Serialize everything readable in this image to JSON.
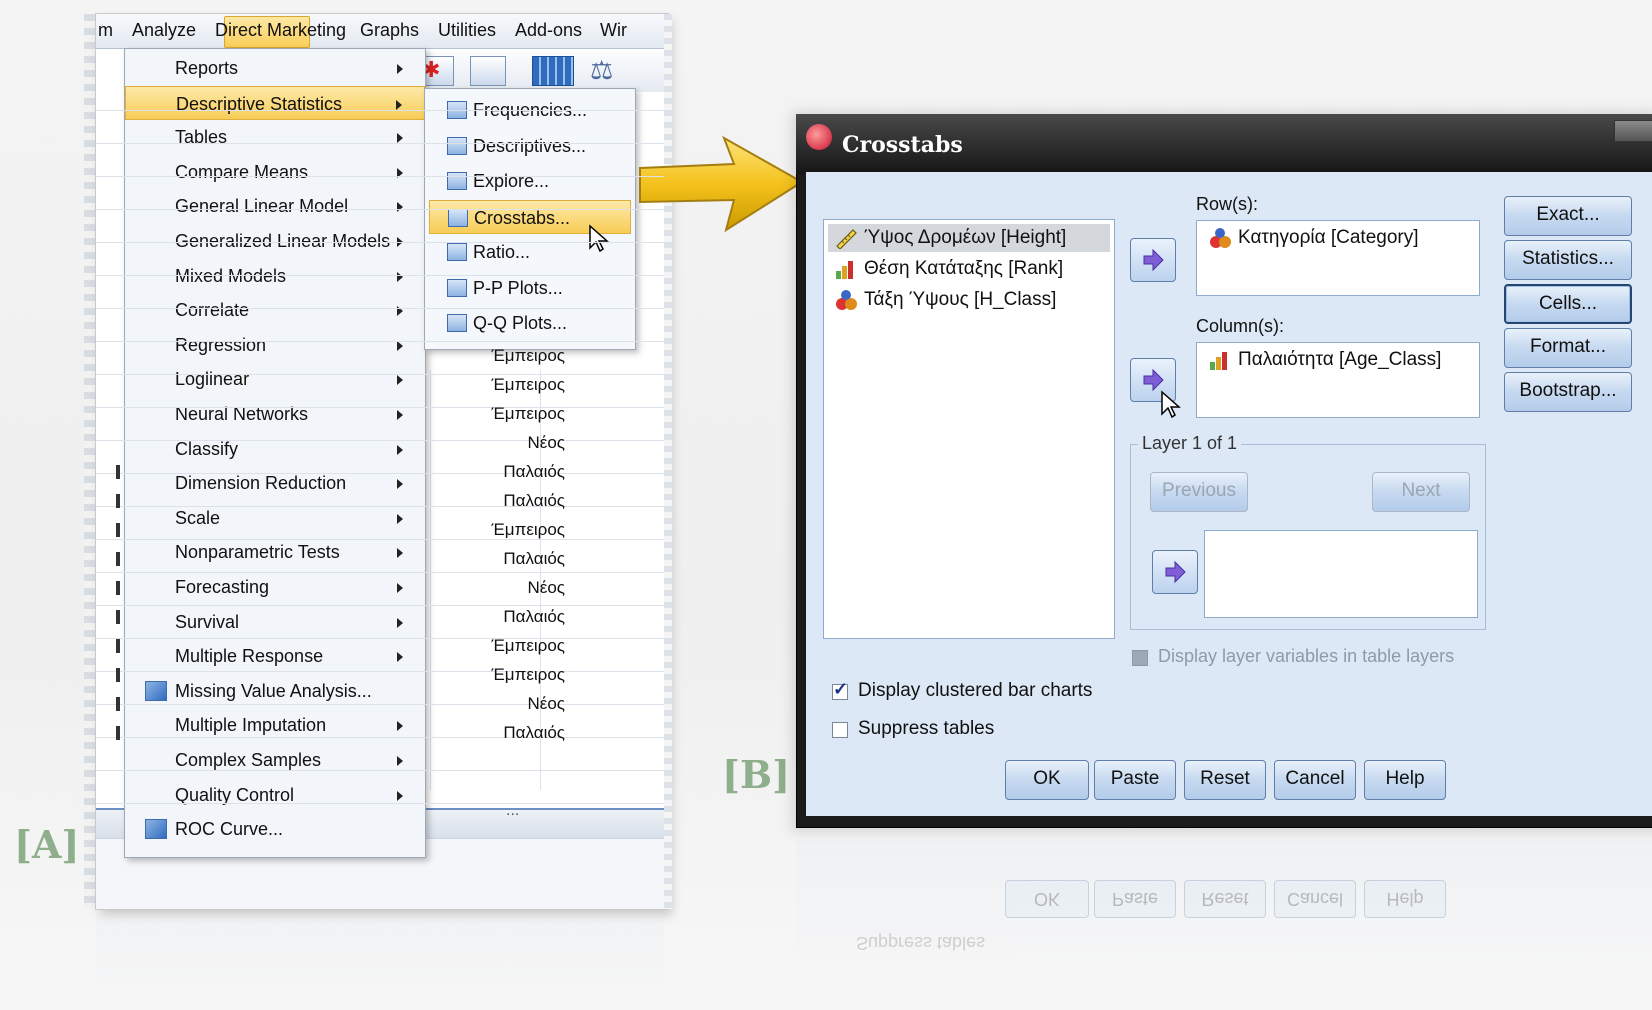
{
  "menubar": {
    "items": [
      "m",
      "Analyze",
      "Direct Marketing",
      "Graphs",
      "Utilities",
      "Add-ons",
      "Wir"
    ],
    "active": "Analyze"
  },
  "analyze_menu": [
    {
      "label": "Reports",
      "submenu": true
    },
    {
      "label": "Descriptive Statistics",
      "submenu": true,
      "selected": true
    },
    {
      "label": "Tables",
      "submenu": true
    },
    {
      "label": "Compare Means",
      "submenu": true
    },
    {
      "label": "General Linear Model",
      "submenu": true
    },
    {
      "label": "Generalized Linear Models",
      "submenu": true
    },
    {
      "label": "Mixed Models",
      "submenu": true
    },
    {
      "label": "Correlate",
      "submenu": true
    },
    {
      "label": "Regression",
      "submenu": true
    },
    {
      "label": "Loglinear",
      "submenu": true
    },
    {
      "label": "Neural Networks",
      "submenu": true
    },
    {
      "label": "Classify",
      "submenu": true
    },
    {
      "label": "Dimension Reduction",
      "submenu": true
    },
    {
      "label": "Scale",
      "submenu": true
    },
    {
      "label": "Nonparametric Tests",
      "submenu": true
    },
    {
      "label": "Forecasting",
      "submenu": true
    },
    {
      "label": "Survival",
      "submenu": true
    },
    {
      "label": "Multiple Response",
      "submenu": true
    },
    {
      "label": "Missing Value Analysis...",
      "submenu": false,
      "icon": "missing-value-icon"
    },
    {
      "label": "Multiple Imputation",
      "submenu": true
    },
    {
      "label": "Complex Samples",
      "submenu": true
    },
    {
      "label": "Quality Control",
      "submenu": true
    },
    {
      "label": "ROC Curve...",
      "submenu": false,
      "icon": "roc-curve-icon"
    }
  ],
  "descriptive_submenu": [
    {
      "label": "Frequencies..."
    },
    {
      "label": "Descriptives..."
    },
    {
      "label": "Explore..."
    },
    {
      "label": "Crosstabs...",
      "selected": true
    },
    {
      "label": "Ratio..."
    },
    {
      "label": "P-P Plots..."
    },
    {
      "label": "Q-Q Plots..."
    }
  ],
  "data_column_values": [
    "Έμπειρος",
    "Έμπειρος",
    "Έμπειρος",
    "Νέος",
    "Παλαιός",
    "Παλαιός",
    "Έμπειρος",
    "Παλαιός",
    "Νέος",
    "Παλαιός",
    "Έμπειρος",
    "Έμπειρος",
    "Νέος",
    "Παλαιός"
  ],
  "statusbar": {
    "dots": "..."
  },
  "labels": {
    "a": "[A]",
    "b": "[B]"
  },
  "dialog": {
    "title": "Crosstabs",
    "source_vars": [
      {
        "label": "Ύψος Δρομέων [Height]",
        "icon": "scale-variable-icon",
        "selected": true
      },
      {
        "label": "Θέση Κατάταξης [Rank]",
        "icon": "ordinal-variable-icon"
      },
      {
        "label": "Τάξη Ύψους [H_Class]",
        "icon": "nominal-variable-icon"
      }
    ],
    "rows_label": "Row(s):",
    "rows_vars": [
      {
        "label": "Κατηγορία [Category]",
        "icon": "nominal-variable-icon"
      }
    ],
    "columns_label": "Column(s):",
    "columns_vars": [
      {
        "label": "Παλαιότητα [Age_Class]",
        "icon": "ordinal-variable-icon"
      }
    ],
    "layer_label": "Layer 1 of 1",
    "previous": "Previous",
    "next": "Next",
    "display_layer": "Display layer variables in table layers",
    "clustered_bar": "Display clustered bar charts",
    "clustered_bar_checked": true,
    "suppress": "Suppress tables",
    "suppress_checked": false,
    "side_buttons": [
      "Exact...",
      "Statistics...",
      "Cells...",
      "Format...",
      "Bootstrap..."
    ],
    "bottom_buttons": [
      "OK",
      "Paste",
      "Reset",
      "Cancel",
      "Help"
    ],
    "reflection_text": "Suppress tables"
  }
}
